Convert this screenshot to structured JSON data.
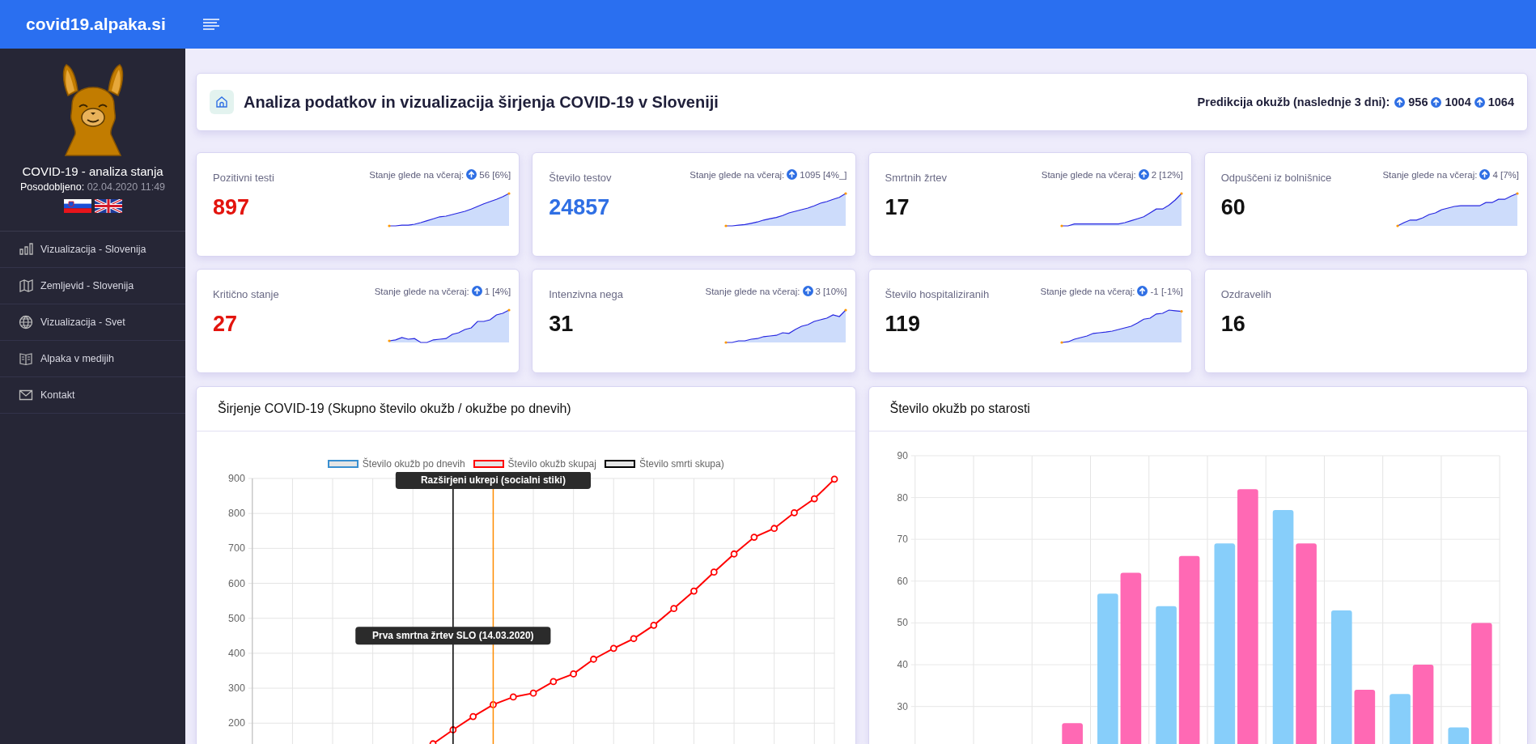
{
  "topbar": {
    "brand": "covid19.alpaka.si"
  },
  "sidebar": {
    "title": "COVID-19 - analiza stanja",
    "updated_label": "Posodobljeno:",
    "updated_value": "02.04.2020 11:49",
    "nav": [
      {
        "label": "Vizualizacija - Slovenija"
      },
      {
        "label": "Zemljevid - Slovenija"
      },
      {
        "label": "Vizualizacija - Svet"
      },
      {
        "label": "Alpaka v medijih"
      },
      {
        "label": "Kontakt"
      }
    ]
  },
  "header": {
    "title": "Analiza podatkov in vizualizacija širjenja COVID-19 v Sloveniji",
    "prediction_label": "Predikcija okužb (naslednje 3 dni):",
    "predictions": [
      "956",
      "1004",
      "1064"
    ]
  },
  "stats": [
    {
      "label": "Pozitivni testi",
      "value": "897",
      "color": "#e3140e",
      "change_label": "Stanje glede na včeraj:",
      "change": "56 [6%]"
    },
    {
      "label": "Število testov",
      "value": "24857",
      "color": "#2f6fe4",
      "change_label": "Stanje glede na včeraj:",
      "change": "1095 [4%_]"
    },
    {
      "label": "Smrtnih žrtev",
      "value": "17",
      "color": "#111111",
      "change_label": "Stanje glede na včeraj:",
      "change": "2 [12%]"
    },
    {
      "label": "Odpuščeni iz bolnišnice",
      "value": "60",
      "color": "#111111",
      "change_label": "Stanje glede na včeraj:",
      "change": "4 [7%]"
    },
    {
      "label": "Kritično stanje",
      "value": "27",
      "color": "#e3140e",
      "change_label": "Stanje glede na včeraj:",
      "change": "1 [4%]"
    },
    {
      "label": "Intenzivna nega",
      "value": "31",
      "color": "#111111",
      "change_label": "Stanje glede na včeraj:",
      "change": "3 [10%]"
    },
    {
      "label": "Število hospitaliziranih",
      "value": "119",
      "color": "#111111",
      "change_label": "Stanje glede na včeraj:",
      "change": "-1 [-1%]"
    },
    {
      "label": "Ozdravelih",
      "value": "16",
      "color": "#111111"
    }
  ],
  "charts": [
    {
      "title": "Širjenje COVID-19 (Skupno število okužb / okužbe po dnevih)",
      "chart_data": {
        "type": "line",
        "ylim": [
          140,
          900
        ],
        "grid": true,
        "yticks": [
          200,
          300,
          400,
          500,
          600,
          700,
          800,
          900
        ],
        "series": [
          {
            "name": "Število okužb po dnevih",
            "color": "#3a8fd0"
          },
          {
            "name": "Število okužb skupaj",
            "color": "#ff0000",
            "marker": "circle",
            "values": [
              null,
              null,
              null,
              null,
              null,
              null,
              null,
              null,
              null,
              141,
              181,
              219,
              253,
              275,
              286,
              319,
              341,
              383,
              414,
              442,
              480,
              528,
              578,
              632,
              684,
              732,
              757,
              802,
              842,
              898
            ]
          },
          {
            "name": "Število smrti skupa)",
            "color": "#000000"
          }
        ],
        "annotations": [
          {
            "text": "Prva smrtna žrtev SLO (14.03.2020)"
          },
          {
            "text": "Razširjeni ukrepi (socialni stiki)"
          }
        ]
      }
    },
    {
      "title": "Število okužb po starosti",
      "chart_data": {
        "type": "bar",
        "ylim": [
          21,
          90
        ],
        "grid": true,
        "yticks": [
          30,
          40,
          50,
          60,
          70,
          80,
          90
        ],
        "series": [
          {
            "color": "#87cefa",
            "values": [
              null,
              null,
              null,
              57,
              54,
              69,
              77,
              53,
              33,
              25
            ]
          },
          {
            "color": "#ff69b4",
            "values": [
              null,
              null,
              26,
              62,
              66,
              82,
              69,
              34,
              40,
              50
            ]
          }
        ]
      }
    }
  ]
}
